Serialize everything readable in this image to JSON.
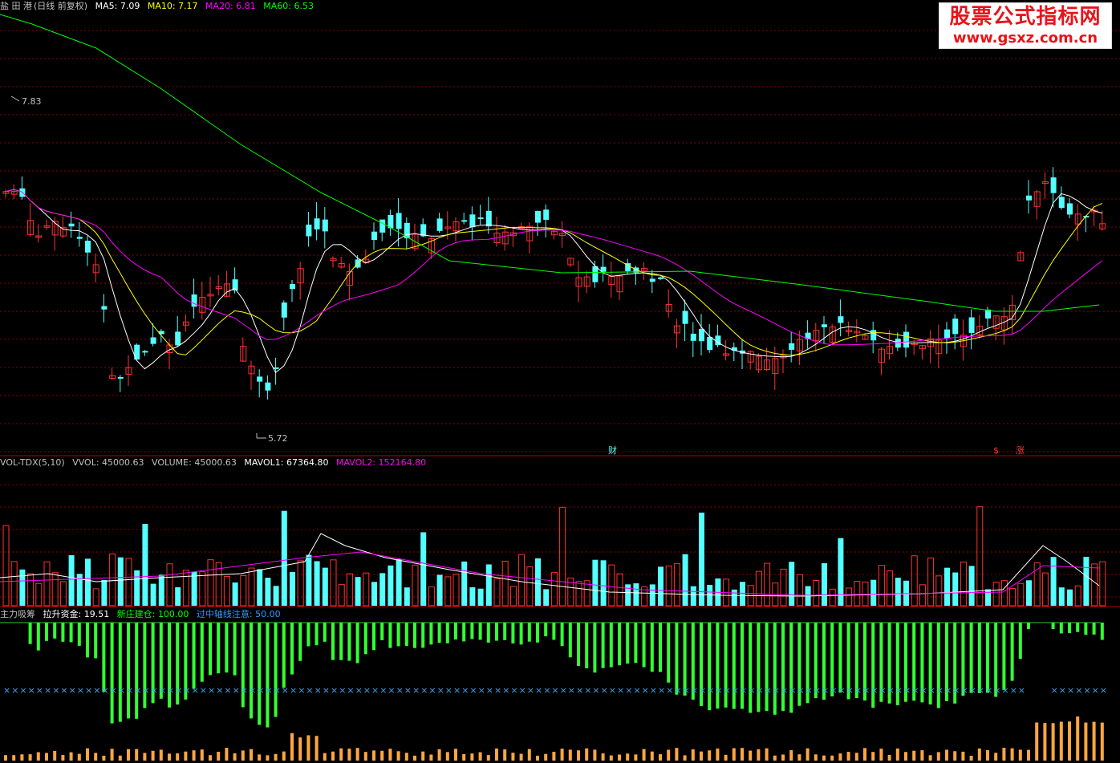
{
  "price_panel": {
    "stock_name": "盐 田 港",
    "period_label": "(日线 前复权)",
    "ma5": {
      "label": "MA5:",
      "value": "7.09",
      "color": "#ffffff"
    },
    "ma10": {
      "label": "MA10:",
      "value": "7.17",
      "color": "#ffff00"
    },
    "ma20": {
      "label": "MA20:",
      "value": "6.81",
      "color": "#ff00ff"
    },
    "ma60": {
      "label": "MA60:",
      "value": "6.53",
      "color": "#00ff00"
    },
    "high_marker": "7.83",
    "low_marker": "5.72",
    "event_markers": [
      "财",
      "$",
      "涨"
    ]
  },
  "volume_panel": {
    "indicator": "VOL-TDX(5,10)",
    "vvol": {
      "label": "VVOL:",
      "value": "45000.63"
    },
    "volume": {
      "label": "VOLUME:",
      "value": "45000.63"
    },
    "mavol1": {
      "label": "MAVOL1:",
      "value": "67364.80",
      "color": "#ffffff"
    },
    "mavol2": {
      "label": "MAVOL2:",
      "value": "152164.80",
      "color": "#ff00ff"
    }
  },
  "indicator_panel": {
    "title": "主力吸筹",
    "pull_fund": {
      "label": "拉升资金:",
      "value": "19.51",
      "color": "#ffffff"
    },
    "new_position": {
      "label": "新庄建仓:",
      "value": "100.00",
      "color": "#00ff00"
    },
    "axis_notice": {
      "label": "过中轴线注意:",
      "value": "50.00",
      "color": "#3399ff"
    }
  },
  "watermark": {
    "line1": "股票公式指标网",
    "line2": "www.gsxz.com.cn"
  },
  "colors": {
    "up": "#ff3232",
    "down": "#54ffff",
    "grid": "#8b0000",
    "green_bar": "#33ff33",
    "orange_bar": "#ffa640",
    "cross": "#3ba7f0"
  }
}
